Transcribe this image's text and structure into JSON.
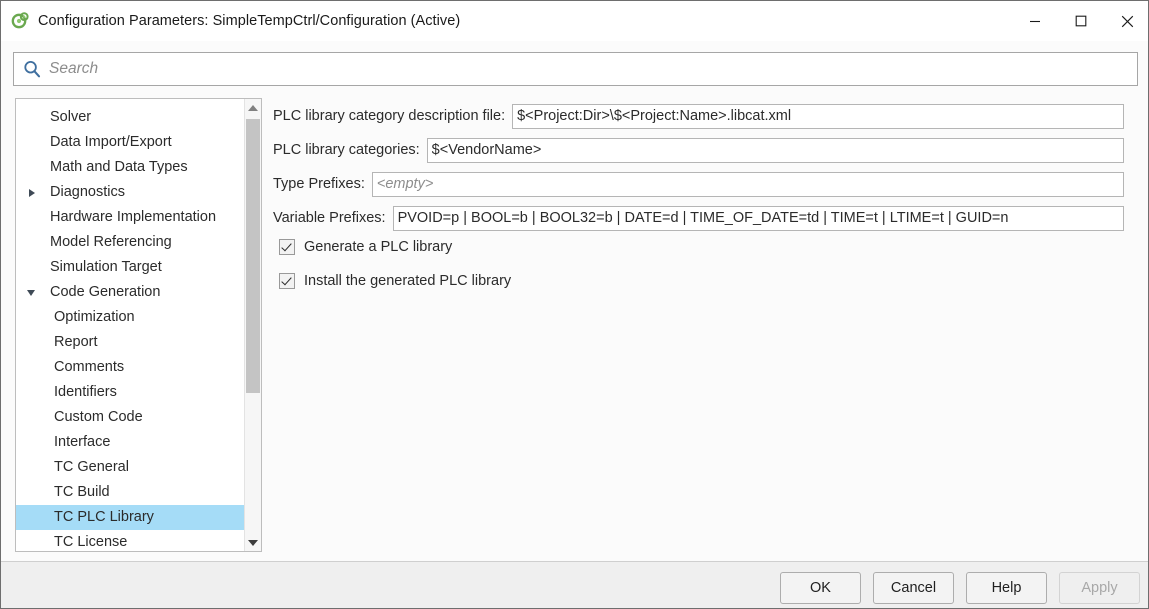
{
  "window": {
    "title": "Configuration Parameters: SimpleTempCtrl/Configuration (Active)",
    "icon": "simulink-config-icon",
    "minimize_label": "Minimize",
    "maximize_label": "Maximize",
    "close_label": "Close"
  },
  "search": {
    "placeholder": "Search",
    "value": "",
    "icon": "search-icon"
  },
  "tree": {
    "items": [
      {
        "label": "Solver",
        "level": 1,
        "twisty": "none",
        "selected": false
      },
      {
        "label": "Data Import/Export",
        "level": 1,
        "twisty": "none",
        "selected": false
      },
      {
        "label": "Math and Data Types",
        "level": 1,
        "twisty": "none",
        "selected": false
      },
      {
        "label": "Diagnostics",
        "level": 1,
        "twisty": "collapsed",
        "selected": false
      },
      {
        "label": "Hardware Implementation",
        "level": 1,
        "twisty": "none",
        "selected": false
      },
      {
        "label": "Model Referencing",
        "level": 1,
        "twisty": "none",
        "selected": false
      },
      {
        "label": "Simulation Target",
        "level": 1,
        "twisty": "none",
        "selected": false
      },
      {
        "label": "Code Generation",
        "level": 1,
        "twisty": "expanded",
        "selected": false
      },
      {
        "label": "Optimization",
        "level": 2,
        "twisty": "none",
        "selected": false
      },
      {
        "label": "Report",
        "level": 2,
        "twisty": "none",
        "selected": false
      },
      {
        "label": "Comments",
        "level": 2,
        "twisty": "none",
        "selected": false
      },
      {
        "label": "Identifiers",
        "level": 2,
        "twisty": "none",
        "selected": false
      },
      {
        "label": "Custom Code",
        "level": 2,
        "twisty": "none",
        "selected": false
      },
      {
        "label": "Interface",
        "level": 2,
        "twisty": "none",
        "selected": false
      },
      {
        "label": "TC General",
        "level": 2,
        "twisty": "none",
        "selected": false
      },
      {
        "label": "TC Build",
        "level": 2,
        "twisty": "none",
        "selected": false
      },
      {
        "label": "TC PLC Library",
        "level": 2,
        "twisty": "none",
        "selected": true
      },
      {
        "label": "TC License",
        "level": 2,
        "twisty": "none",
        "selected": false
      }
    ],
    "selection_color": "#a5dcf7",
    "scrollbar": {
      "up_icon": "triangle-up-icon",
      "down_icon": "triangle-down-icon"
    }
  },
  "pane": {
    "fields": [
      {
        "id": "catfile",
        "label": "PLC library category description file:",
        "value": "$<Project:Dir>\\$<Project:Name>.libcat.xml",
        "placeholder": ""
      },
      {
        "id": "cats",
        "label": "PLC library categories:",
        "value": "$<VendorName>",
        "placeholder": ""
      },
      {
        "id": "typepfx",
        "label": "Type Prefixes:",
        "value": "",
        "placeholder": "<empty>"
      },
      {
        "id": "varpfx",
        "label": "Variable Prefixes:",
        "value": "PVOID=p | BOOL=b | BOOL32=b | DATE=d | TIME_OF_DATE=td | TIME=t | LTIME=t | GUID=n",
        "placeholder": ""
      }
    ],
    "checkboxes": [
      {
        "id": "generate",
        "label": "Generate a PLC library",
        "checked": true
      },
      {
        "id": "install",
        "label": "Install the generated PLC library",
        "checked": true
      }
    ]
  },
  "footer": {
    "buttons": [
      {
        "label": "OK",
        "disabled": false
      },
      {
        "label": "Cancel",
        "disabled": false
      },
      {
        "label": "Help",
        "disabled": false
      },
      {
        "label": "Apply",
        "disabled": true
      }
    ]
  }
}
